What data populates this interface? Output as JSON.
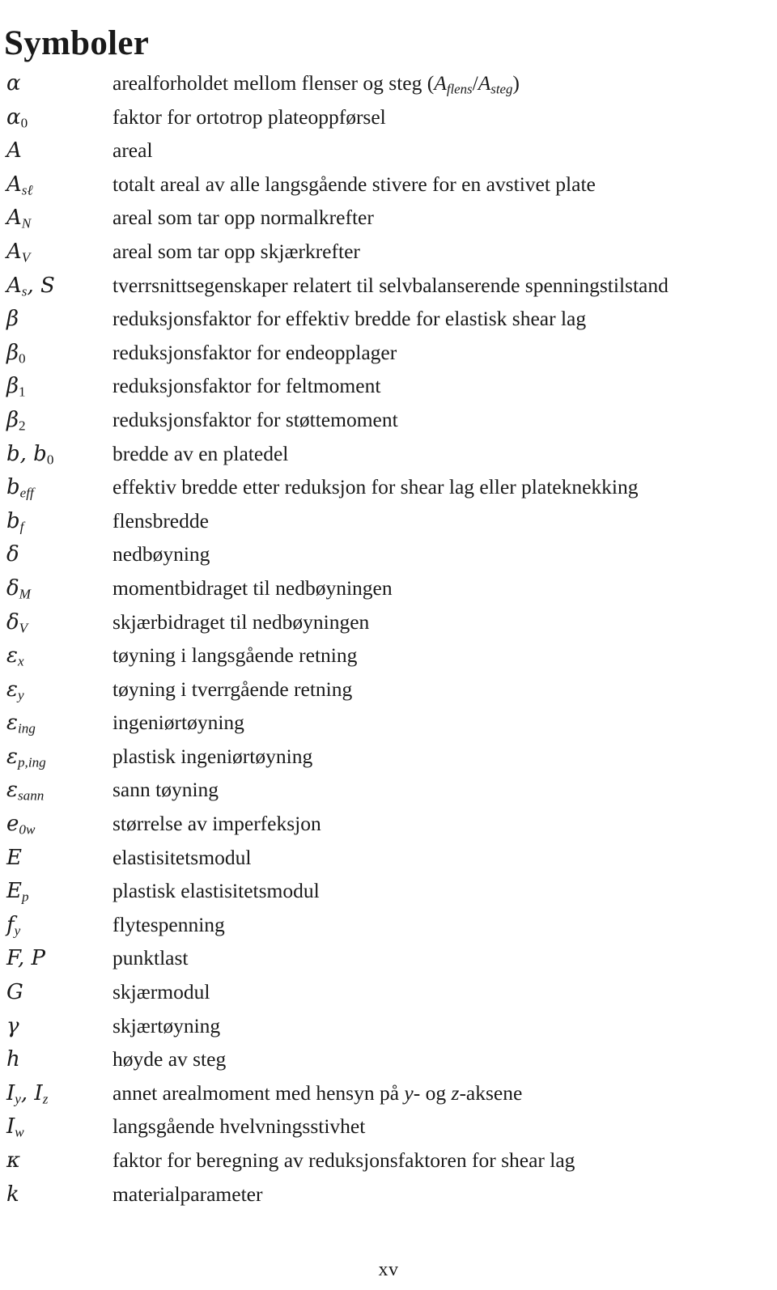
{
  "document": {
    "title": "Symboler",
    "page_number": "xv",
    "language": "Norwegian"
  },
  "entries": [
    {
      "symbol_plain": "α",
      "symbol_base": "α",
      "symbol_sub": "",
      "description_plain": "arealforholdet mellom flenser og steg (A_flens/A_steg)",
      "description_prefix": "arealforholdet mellom flenser og steg (",
      "math_a": "A",
      "math_a_sub": "flens",
      "math_sep": "/",
      "math_b": "A",
      "math_b_sub": "steg",
      "description_suffix": ")"
    },
    {
      "symbol_plain": "α0",
      "symbol_base": "α",
      "symbol_sub": "0",
      "description_plain": "faktor for ortotrop plateoppførsel"
    },
    {
      "symbol_plain": "A",
      "symbol_base": "A",
      "symbol_sub": "",
      "description_plain": "areal"
    },
    {
      "symbol_plain": "Asℓ",
      "symbol_base": "A",
      "symbol_sub": "sℓ",
      "description_plain": "totalt areal av alle langsgående stivere for en avstivet plate"
    },
    {
      "symbol_plain": "AN",
      "symbol_base": "A",
      "symbol_sub": "N",
      "description_plain": "areal som tar opp normalkrefter"
    },
    {
      "symbol_plain": "AV",
      "symbol_base": "A",
      "symbol_sub": "V",
      "description_plain": "areal som tar opp skjærkrefter"
    },
    {
      "symbol_plain": "As, S",
      "symbol_base": "A",
      "symbol_sub": "s",
      "symbol_tail": ", S",
      "description_plain": "tverrsnittsegenskaper relatert til selvbalanserende spenningstilstand"
    },
    {
      "symbol_plain": "β",
      "symbol_base": "β",
      "symbol_sub": "",
      "description_plain": "reduksjonsfaktor for effektiv bredde for elastisk shear lag"
    },
    {
      "symbol_plain": "β0",
      "symbol_base": "β",
      "symbol_sub": "0",
      "description_plain": "reduksjonsfaktor for endeopplager"
    },
    {
      "symbol_plain": "β1",
      "symbol_base": "β",
      "symbol_sub": "1",
      "description_plain": "reduksjonsfaktor for feltmoment"
    },
    {
      "symbol_plain": "β2",
      "symbol_base": "β",
      "symbol_sub": "2",
      "description_plain": "reduksjonsfaktor for støttemoment"
    },
    {
      "symbol_plain": "b, b0",
      "symbol_base": "b",
      "symbol_sub": "",
      "symbol_tail": ", b",
      "symbol_tail_sub": "0",
      "description_plain": "bredde av en platedel"
    },
    {
      "symbol_plain": "beff",
      "symbol_base": "b",
      "symbol_sub": "eff",
      "description_plain": "effektiv bredde etter reduksjon for shear lag eller plateknekking"
    },
    {
      "symbol_plain": "bf",
      "symbol_base": "b",
      "symbol_sub": "f",
      "description_plain": "flensbredde"
    },
    {
      "symbol_plain": "δ",
      "symbol_base": "δ",
      "symbol_sub": "",
      "description_plain": "nedbøyning"
    },
    {
      "symbol_plain": "δM",
      "symbol_base": "δ",
      "symbol_sub": "M",
      "description_plain": "momentbidraget til nedbøyningen"
    },
    {
      "symbol_plain": "δV",
      "symbol_base": "δ",
      "symbol_sub": "V",
      "description_plain": "skjærbidraget til nedbøyningen"
    },
    {
      "symbol_plain": "εx",
      "symbol_base": "ε",
      "symbol_sub": "x",
      "description_plain": "tøyning i langsgående retning"
    },
    {
      "symbol_plain": "εy",
      "symbol_base": "ε",
      "symbol_sub": "y",
      "description_plain": "tøyning i tverrgående retning"
    },
    {
      "symbol_plain": "εing",
      "symbol_base": "ε",
      "symbol_sub": "ing",
      "description_plain": "ingeniørtøyning"
    },
    {
      "symbol_plain": "εp,ing",
      "symbol_base": "ε",
      "symbol_sub": "p,ing",
      "description_plain": "plastisk ingeniørtøyning"
    },
    {
      "symbol_plain": "εsann",
      "symbol_base": "ε",
      "symbol_sub": "sann",
      "description_plain": "sann tøyning"
    },
    {
      "symbol_plain": "e0w",
      "symbol_base": "e",
      "symbol_sub": "0w",
      "description_plain": "størrelse av imperfeksjon"
    },
    {
      "symbol_plain": "E",
      "symbol_base": "E",
      "symbol_sub": "",
      "description_plain": "elastisitetsmodul"
    },
    {
      "symbol_plain": "Ep",
      "symbol_base": "E",
      "symbol_sub": "p",
      "description_plain": "plastisk elastisitetsmodul"
    },
    {
      "symbol_plain": "fy",
      "symbol_base": "f",
      "symbol_sub": "y",
      "description_plain": "flytespenning"
    },
    {
      "symbol_plain": "F, P",
      "symbol_base": "F",
      "symbol_sub": "",
      "symbol_tail": ", P",
      "description_plain": "punktlast"
    },
    {
      "symbol_plain": "G",
      "symbol_base": "G",
      "symbol_sub": "",
      "description_plain": "skjærmodul"
    },
    {
      "symbol_plain": "γ",
      "symbol_base": "γ",
      "symbol_sub": "",
      "description_plain": "skjærtøyning"
    },
    {
      "symbol_plain": "h",
      "symbol_base": "h",
      "symbol_sub": "",
      "description_plain": "høyde av steg"
    },
    {
      "symbol_plain": "Iy, Iz",
      "symbol_base": "I",
      "symbol_sub": "y",
      "symbol_tail": ", I",
      "symbol_tail_sub": "z",
      "description_plain": "annet arealmoment med hensyn på y- og z-aksene",
      "description_prefix": "annet arealmoment med hensyn på ",
      "math_a": "y",
      "description_mid": "- og ",
      "math_b": "z",
      "description_suffix": "-aksene"
    },
    {
      "symbol_plain": "Iw",
      "symbol_base": "I",
      "symbol_sub": "w",
      "description_plain": "langsgående hvelvningsstivhet"
    },
    {
      "symbol_plain": "κ",
      "symbol_base": "κ",
      "symbol_sub": "",
      "description_plain": "faktor for beregning av reduksjonsfaktoren for shear lag"
    },
    {
      "symbol_plain": "k",
      "symbol_base": "k",
      "symbol_sub": "",
      "description_plain": "materialparameter"
    }
  ]
}
